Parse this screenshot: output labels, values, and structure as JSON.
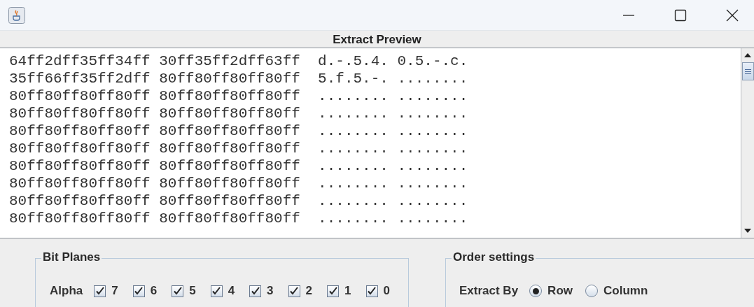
{
  "window": {
    "title": "Extract Preview"
  },
  "preview_lines": [
    "64ff2dff35ff34ff 30ff35ff2dff63ff  d.-.5.4. 0.5.-.c.",
    "35ff66ff35ff2dff 80ff80ff80ff80ff  5.f.5.-. ........",
    "80ff80ff80ff80ff 80ff80ff80ff80ff  ........ ........",
    "80ff80ff80ff80ff 80ff80ff80ff80ff  ........ ........",
    "80ff80ff80ff80ff 80ff80ff80ff80ff  ........ ........",
    "80ff80ff80ff80ff 80ff80ff80ff80ff  ........ ........",
    "80ff80ff80ff80ff 80ff80ff80ff80ff  ........ ........",
    "80ff80ff80ff80ff 80ff80ff80ff80ff  ........ ........",
    "80ff80ff80ff80ff 80ff80ff80ff80ff  ........ ........",
    "80ff80ff80ff80ff 80ff80ff80ff80ff  ........ ........"
  ],
  "bit_planes": {
    "title": "Bit Planes",
    "channel": "Alpha",
    "bits": [
      {
        "label": "7",
        "checked": true
      },
      {
        "label": "6",
        "checked": true
      },
      {
        "label": "5",
        "checked": true
      },
      {
        "label": "4",
        "checked": true
      },
      {
        "label": "3",
        "checked": true
      },
      {
        "label": "2",
        "checked": true
      },
      {
        "label": "1",
        "checked": true
      },
      {
        "label": "0",
        "checked": true
      }
    ]
  },
  "order_settings": {
    "title": "Order settings",
    "label": "Extract By",
    "options": [
      {
        "label": "Row",
        "selected": true
      },
      {
        "label": "Column",
        "selected": false
      }
    ]
  }
}
